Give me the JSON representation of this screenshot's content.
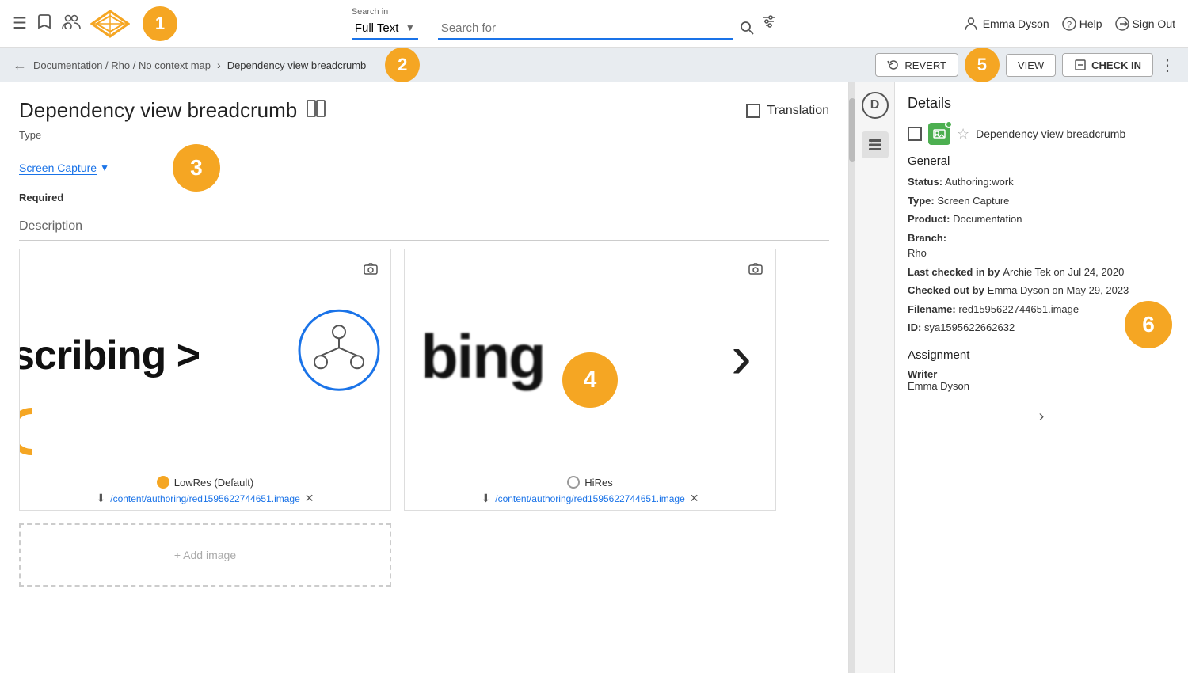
{
  "nav": {
    "menu_icon": "☰",
    "bookmark_icon": "🔖",
    "users_icon": "👥",
    "search_in_label": "Search in",
    "search_in_value": "Full Text",
    "search_placeholder": "Search for",
    "search_icon": "🔍",
    "filter_icon": "⊞",
    "user_icon": "👤",
    "user_name": "Emma Dyson",
    "help_label": "Help",
    "signout_label": "Sign Out"
  },
  "breadcrumb": {
    "back_icon": "←",
    "path": "Documentation / Rho /  No context map",
    "separator": "›",
    "current": "Dependency view breadcrumb",
    "revert_label": "REVERT",
    "view_label": "VIEW",
    "checkin_label": "CHECK IN",
    "kebab": "⋮"
  },
  "toolbar": {
    "badge_2": "2",
    "badge_5": "5"
  },
  "main": {
    "title": "Dependency view breadcrumb",
    "split_icon": "⊡",
    "translation_label": "Translation",
    "type_label": "Type",
    "type_value": "Screen Capture",
    "required_label": "Required",
    "description_label": "Description",
    "image_left": {
      "radio_label": "LowRes (Default)",
      "path": "/content/authoring/red1595622744651.image"
    },
    "image_right": {
      "radio_label": "HiRes",
      "path": "/content/authoring/red1595622744651.image"
    },
    "badges": {
      "b3": "3",
      "b4": "4"
    }
  },
  "details": {
    "panel_title": "Details",
    "file_icon": "🖼",
    "filename": "Dependency view breadcrumb",
    "general_title": "General",
    "status_label": "Status:",
    "status_value": "Authoring:work",
    "type_label": "Type:",
    "type_value": "Screen Capture",
    "product_label": "Product:",
    "product_value": "Documentation",
    "branch_label": "Branch:",
    "branch_value": "Rho",
    "last_checkedin_label": "Last checked in by",
    "last_checkedin_value": "Archie Tek on Jul 24, 2020",
    "checked_out_label": "Checked out by",
    "checked_out_value": "Emma Dyson on May 29, 2023",
    "filename_label": "Filename:",
    "filename_value": "red1595622744651.image",
    "id_label": "ID:",
    "id_value": "sya1595622662632",
    "assignment_title": "Assignment",
    "writer_label": "Writer",
    "writer_value": "Emma Dyson",
    "badge_6": "6"
  },
  "sidebar_icons": {
    "d_label": "D",
    "lines_icon": "≡",
    "chevron_right": "›"
  }
}
